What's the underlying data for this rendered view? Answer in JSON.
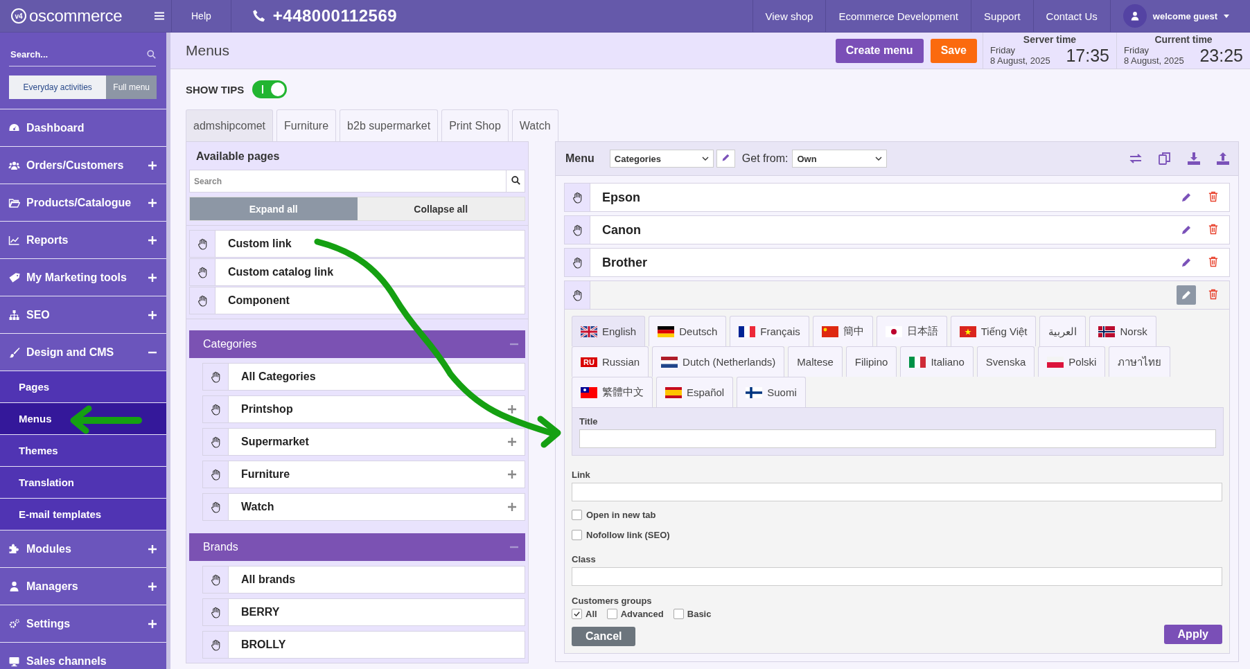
{
  "top_bar": {
    "logo_badge": "v4",
    "logo": "oscommerce",
    "help": "Help",
    "phone": "+448000112569",
    "links": [
      "View shop",
      "Ecommerce Development",
      "Support",
      "Contact Us"
    ],
    "user": "welcome guest"
  },
  "sidebar": {
    "search": {
      "placeholder": "Search..."
    },
    "modes": [
      {
        "label": "Everyday activities",
        "selected": true
      },
      {
        "label": "Full menu",
        "selected": false
      }
    ],
    "items": [
      {
        "label": "Dashboard"
      },
      {
        "label": "Orders/Customers",
        "expanded": false
      },
      {
        "label": "Products/Catalogue",
        "expanded": false
      },
      {
        "label": "Reports",
        "expanded": false
      },
      {
        "label": "My Marketing tools",
        "expanded": false
      },
      {
        "label": "SEO",
        "expanded": false
      },
      {
        "label": "Design and CMS",
        "expanded": true,
        "children": [
          {
            "label": "Pages",
            "selected": false
          },
          {
            "label": "Menus",
            "selected": true
          },
          {
            "label": "Themes",
            "selected": false
          },
          {
            "label": "Translation",
            "selected": false
          },
          {
            "label": "E-mail templates",
            "selected": false
          }
        ]
      },
      {
        "label": "Modules",
        "expanded": false
      },
      {
        "label": "Managers",
        "expanded": false
      },
      {
        "label": "Settings",
        "expanded": false
      },
      {
        "label": "Sales channels"
      }
    ]
  },
  "header": {
    "title": "Menus",
    "buttons": [
      {
        "label": "Create menu",
        "kind": "primary"
      },
      {
        "label": "Save",
        "kind": "accent"
      }
    ],
    "clocks": [
      {
        "label": "Server time",
        "day": "Friday",
        "date": "8 August, 2025",
        "time": "17:35"
      },
      {
        "label": "Current time",
        "day": "Friday",
        "date": "8 August, 2025",
        "time": "23:25"
      }
    ]
  },
  "show_tips": {
    "label": "SHOW TIPS",
    "on": true
  },
  "store_tabs": [
    {
      "label": "admshipcomet",
      "selected": true
    },
    {
      "label": "Furniture",
      "selected": false
    },
    {
      "label": "b2b supermarket",
      "selected": false
    },
    {
      "label": "Print Shop",
      "selected": false
    },
    {
      "label": "Watch",
      "selected": false
    }
  ],
  "available_pages": {
    "title": "Available pages",
    "search": {
      "placeholder": "Search"
    },
    "expand_all": "Expand all",
    "collapse_all": "Collapse all",
    "items": [
      {
        "label": "Custom link"
      },
      {
        "label": "Custom catalog link"
      },
      {
        "label": "Component"
      }
    ],
    "sections": [
      {
        "title": "Categories",
        "expanded": true,
        "items": [
          {
            "label": "All Categories"
          },
          {
            "label": "Printshop",
            "expanded": false
          },
          {
            "label": "Supermarket",
            "expanded": false
          },
          {
            "label": "Furniture",
            "expanded": false
          },
          {
            "label": "Watch",
            "expanded": false
          }
        ]
      },
      {
        "title": "Brands",
        "expanded": true,
        "items": [
          {
            "label": "All brands"
          },
          {
            "label": "BERRY"
          },
          {
            "label": "BROLLY"
          }
        ]
      }
    ]
  },
  "menu_editor": {
    "label": "Menu",
    "menu_select": "Categories",
    "get_from_label": "Get from:",
    "get_from": "Own",
    "items": [
      {
        "label": "Epson",
        "editing": false
      },
      {
        "label": "Canon",
        "editing": false
      },
      {
        "label": "Brother",
        "editing": false
      },
      {
        "editing": true
      }
    ],
    "languages": [
      {
        "label": "English",
        "selected": true
      },
      {
        "label": "Deutsch",
        "selected": false
      },
      {
        "label": "Français",
        "selected": false
      },
      {
        "label": "簡中",
        "selected": false
      },
      {
        "label": "日本語",
        "selected": false
      },
      {
        "label": "Tiếng Việt",
        "selected": false
      },
      {
        "label": "العربية",
        "selected": false
      },
      {
        "label": "Norsk",
        "selected": false
      },
      {
        "label": "Russian",
        "badge": "RU",
        "selected": false
      },
      {
        "label": "Dutch (Netherlands)",
        "selected": false
      },
      {
        "label": "Maltese",
        "selected": false
      },
      {
        "label": "Filipino",
        "selected": false
      },
      {
        "label": "Italiano",
        "selected": false
      },
      {
        "label": "Svenska",
        "selected": false
      },
      {
        "label": "Polski",
        "selected": false
      },
      {
        "label": "ภาษาไทย",
        "selected": false
      },
      {
        "label": "繁體中文",
        "selected": false
      },
      {
        "label": "Español",
        "selected": false
      },
      {
        "label": "Suomi",
        "selected": false
      }
    ],
    "title_label": "Title",
    "link_label": "Link",
    "options": [
      {
        "label": "Open in new tab",
        "checked": false
      },
      {
        "label": "Nofollow link (SEO)",
        "checked": false
      }
    ],
    "class_label": "Class",
    "groups_label": "Customers groups",
    "groups": [
      {
        "label": "All",
        "checked": true
      },
      {
        "label": "Advanced",
        "checked": false
      },
      {
        "label": "Basic",
        "checked": false
      }
    ],
    "cancel": "Cancel",
    "apply": "Apply"
  }
}
